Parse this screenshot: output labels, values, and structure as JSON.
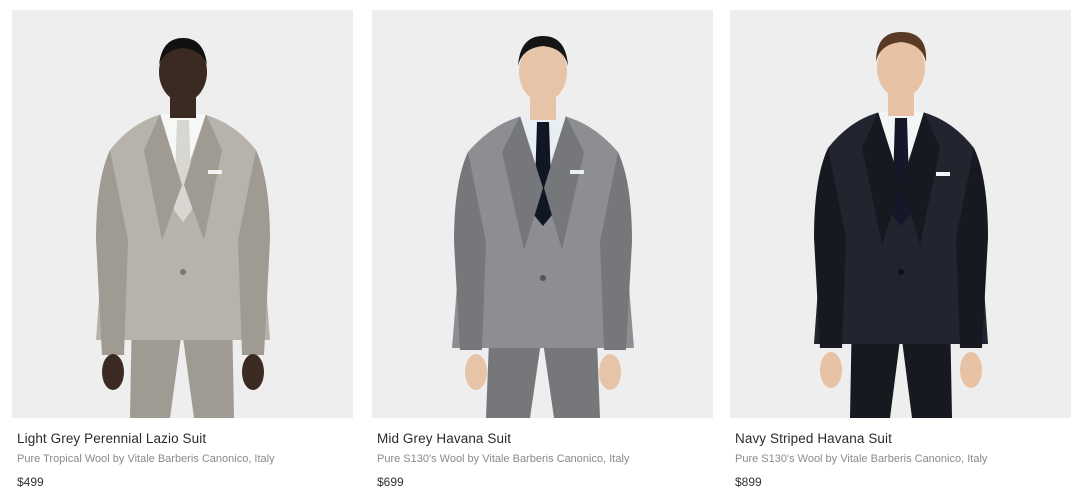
{
  "products": [
    {
      "name": "Light Grey Perennial Lazio Suit",
      "description": "Pure Tropical Wool by Vitale Barberis Canonico, Italy",
      "price": "$499",
      "colors": {
        "suit": "#b7b2aa",
        "suit_shade": "#9f9a92",
        "tie": "#d8d6d1",
        "skin": "#3b2a22",
        "hair": "#111111"
      }
    },
    {
      "name": "Mid Grey Havana Suit",
      "description": "Pure S130's Wool by Vitale Barberis Canonico, Italy",
      "price": "$699",
      "colors": {
        "suit": "#8d8e91",
        "suit_shade": "#76777a",
        "tie": "#111624",
        "skin": "#e6c4a8",
        "hair": "#151515"
      }
    },
    {
      "name": "Navy Striped Havana Suit",
      "description": "Pure S130's Wool by Vitale Barberis Canonico, Italy",
      "price": "$899",
      "colors": {
        "suit": "#22252f",
        "suit_shade": "#171920",
        "tie": "#14182a",
        "skin": "#e8c2a4",
        "hair": "#5a3a24"
      }
    }
  ]
}
